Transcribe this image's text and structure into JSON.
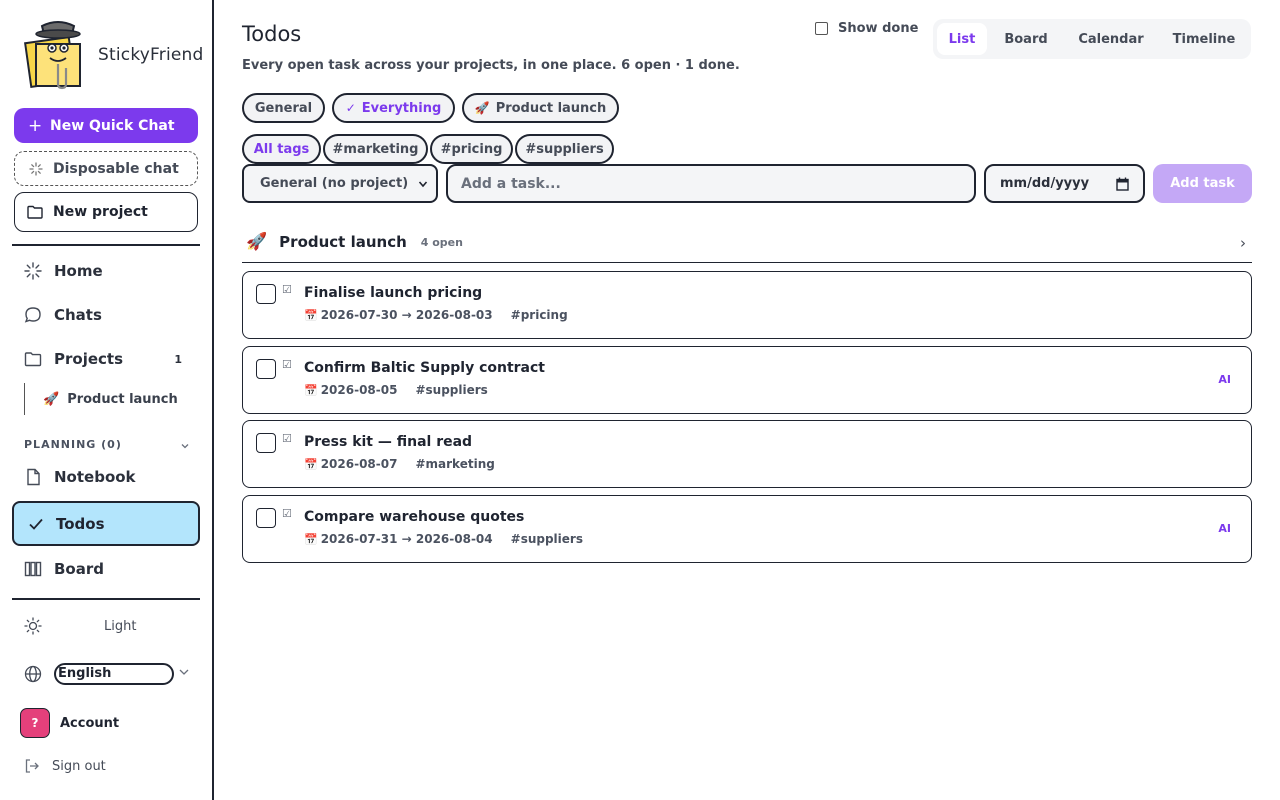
{
  "app": {
    "name": "StickyFriend"
  },
  "sidebar": {
    "new_quick_chat": "New Quick Chat",
    "disposable_chat": "Disposable chat",
    "new_project": "New project",
    "nav": {
      "home": "Home",
      "chats": "Chats",
      "projects": "Projects",
      "projects_count": "1",
      "project_item": {
        "emoji": "🚀",
        "label": "Product launch"
      }
    },
    "planning_label": "PLANNING (0)",
    "planning": {
      "notebook": "Notebook",
      "todos": "Todos",
      "board": "Board"
    },
    "theme": {
      "icon": "sun-icon",
      "label": "Light"
    },
    "language": {
      "icon": "globe-icon",
      "value": "English"
    },
    "account": {
      "avatar": "?",
      "label": "Account",
      "avatar_color": "#e4407b"
    },
    "sign_out": "Sign out"
  },
  "main": {
    "title": "Todos",
    "subtitle": "Every open task across your projects, in one place. 6 open · 1 done.",
    "show_done": {
      "label": "Show done",
      "checked": false
    },
    "view_tabs": [
      {
        "label": "List",
        "active": true
      },
      {
        "label": "Board",
        "active": false
      },
      {
        "label": "Calendar",
        "active": false
      },
      {
        "label": "Timeline",
        "active": false
      }
    ],
    "scope_chips": [
      {
        "label": "General",
        "active": false
      },
      {
        "label": "Everything",
        "active": true,
        "icon": "✓"
      },
      {
        "label": "Product launch",
        "active": false,
        "icon": "🚀"
      }
    ],
    "tag_chips": [
      {
        "label": "All tags",
        "active": true
      },
      {
        "label": "#marketing",
        "active": false
      },
      {
        "label": "#pricing",
        "active": false
      },
      {
        "label": "#suppliers",
        "active": false
      }
    ],
    "composer": {
      "project_select": "General (no project)",
      "task_placeholder": "Add a task...",
      "date_placeholder": "mm/dd/yyyy",
      "add_button": "Add task"
    },
    "group": {
      "emoji": "🚀",
      "name": "Product launch",
      "count": "4 open",
      "tasks": [
        {
          "title": "Finalise launch pricing",
          "date": "2026-07-30 → 2026-08-03",
          "tag": "#pricing",
          "ai": ""
        },
        {
          "title": "Confirm Baltic Supply contract",
          "date": "2026-08-05",
          "tag": "#suppliers",
          "ai": "AI"
        },
        {
          "title": "Press kit — final read",
          "date": "2026-08-07",
          "tag": "#marketing",
          "ai": ""
        },
        {
          "title": "Compare warehouse quotes",
          "date": "2026-07-31 → 2026-08-04",
          "tag": "#suppliers",
          "ai": "AI"
        }
      ]
    }
  },
  "colors": {
    "accent": "#7c3aed",
    "active_nav_bg": "#b3e5fc",
    "add_button_bg": "#c4a8f6"
  }
}
